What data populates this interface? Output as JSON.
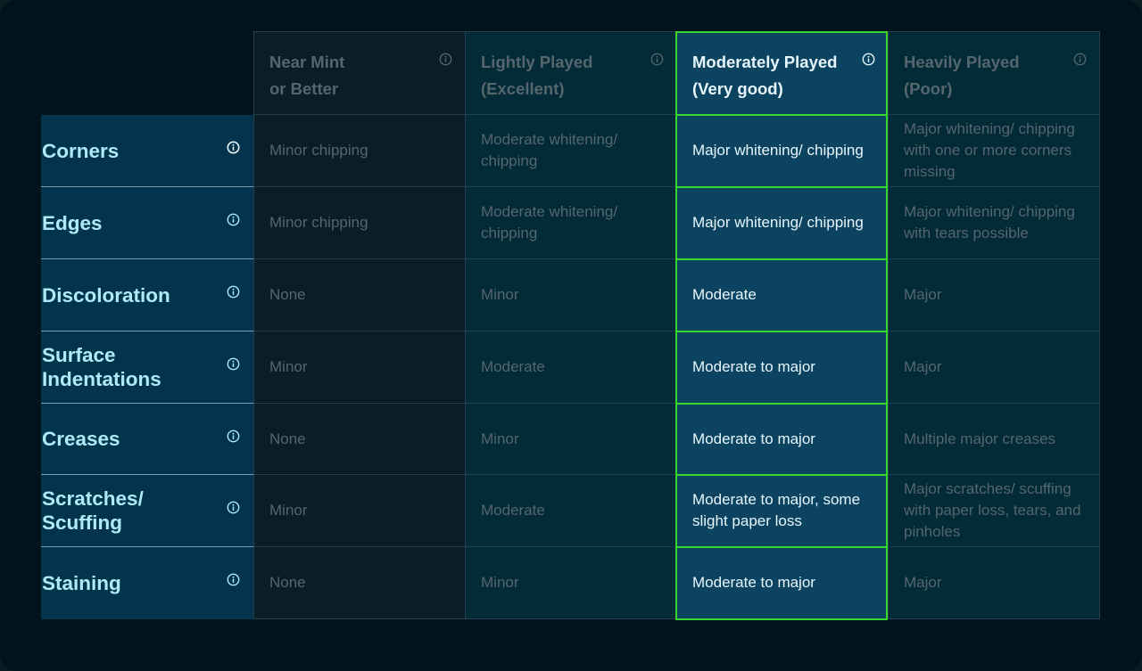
{
  "columns": [
    {
      "line1": "Near Mint",
      "line2": "or Better"
    },
    {
      "line1": "Lightly Played",
      "line2": "(Excellent)"
    },
    {
      "line1": "Moderately Played",
      "line2": "(Very good)"
    },
    {
      "line1": "Heavily Played",
      "line2": "(Poor)"
    }
  ],
  "rows": [
    {
      "label": "Corners",
      "values": [
        "Minor chipping",
        "Moderate whitening/ chipping",
        "Major whitening/ chipping",
        "Major whitening/ chipping with one or more corners missing"
      ]
    },
    {
      "label": "Edges",
      "values": [
        "Minor chipping",
        "Moderate whitening/ chipping",
        "Major whitening/ chipping",
        "Major whitening/ chipping with tears possible"
      ]
    },
    {
      "label": "Discoloration",
      "values": [
        "None",
        "Minor",
        "Moderate",
        "Major"
      ]
    },
    {
      "label": "Surface Indentations",
      "values": [
        "Minor",
        "Moderate",
        "Moderate to major",
        "Major"
      ]
    },
    {
      "label": "Creases",
      "values": [
        "None",
        "Minor",
        "Moderate to major",
        "Multiple major creases"
      ]
    },
    {
      "label": "Scratches/ Scuffing",
      "values": [
        "Minor",
        "Moderate",
        "Moderate to major, some slight paper loss",
        "Major scratches/ scuffing with paper loss, tears, and pinholes"
      ]
    },
    {
      "label": "Staining",
      "values": [
        "None",
        "Minor",
        "Moderate to major",
        "Major"
      ]
    }
  ],
  "highlighted_column_index": 2,
  "icons": {
    "header_info": "info-icon",
    "row_info": "info-icon"
  },
  "colors": {
    "highlight_border": "#39d52d",
    "highlight_bg": "#0c4361",
    "row_label_bg": "#03344d",
    "row_label_text": "#aeeaf8",
    "muted_text": "#55666d"
  }
}
